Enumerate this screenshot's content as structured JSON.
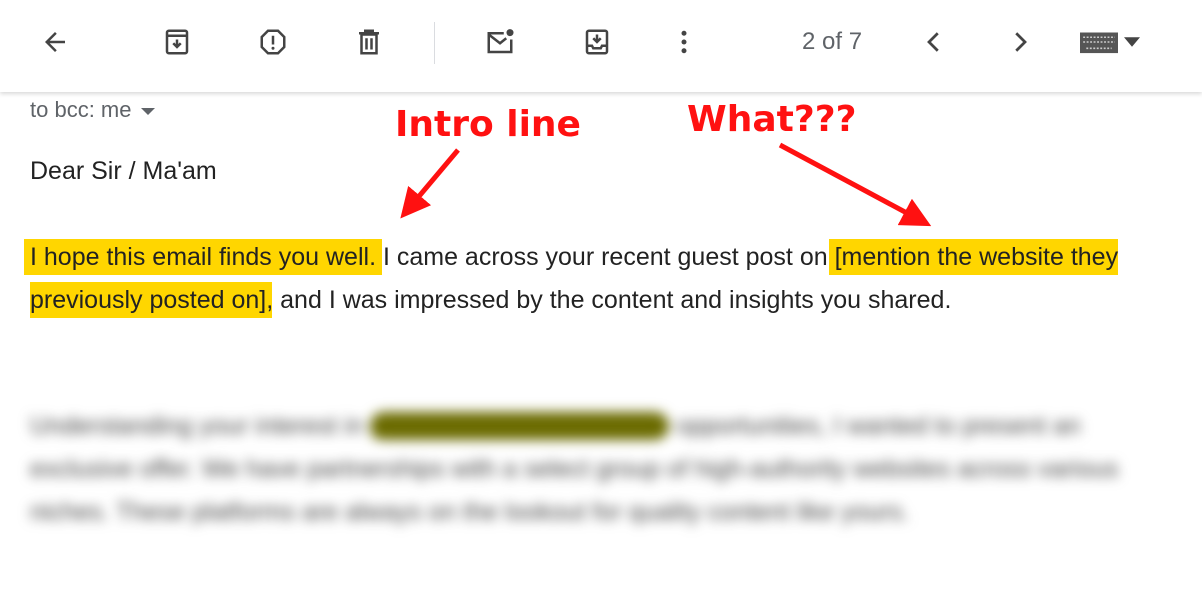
{
  "toolbar": {
    "icons": [
      "back-arrow-icon",
      "archive-icon",
      "report-spam-icon",
      "delete-icon",
      "mark-unread-icon",
      "move-to-inbox-icon",
      "more-vert-icon",
      "prev-icon",
      "next-icon",
      "keyboard-icon",
      "dropdown-caret-icon"
    ],
    "page_count": "2 of 7"
  },
  "email": {
    "recipient": "to bcc: me",
    "greeting": "Dear Sir / Ma'am",
    "intro_highlight": "I hope this email finds you well.",
    "text1": " I came across your recent guest post on ",
    "mention_highlight": "[mention the website they previously posted on]",
    "text2": ", and I was impressed by the content and insights you shared.",
    "blurred_a": "Understanding your interest in ",
    "blurred_mark": "guest posting opportunities",
    "blurred_b": " opportunities, I wanted to present an exclusive offer. We have partnerships with a select group of high-authority websites across various niches. These platforms are always on the lookout for quality content like yours."
  },
  "annotations": {
    "intro": "Intro line",
    "what": "What???",
    "color": "#ff1111"
  },
  "colors": {
    "highlight": "#ffd600"
  }
}
